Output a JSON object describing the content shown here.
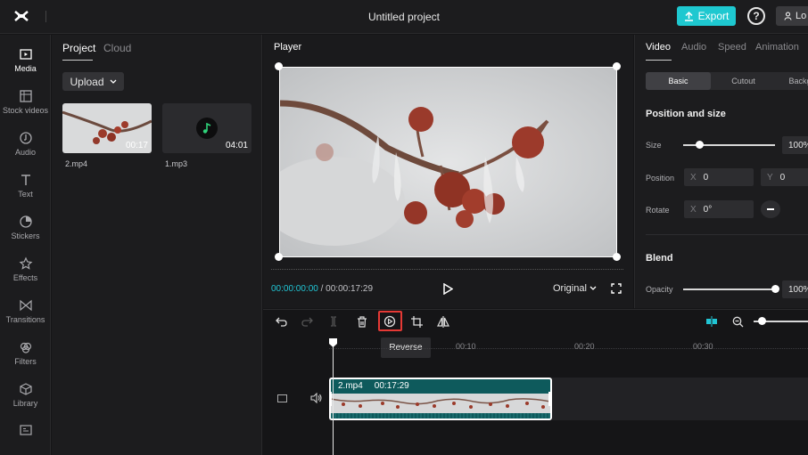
{
  "app": {
    "title": "Untitled project",
    "export_label": "Export",
    "help_label": "?",
    "login_label": "Lo"
  },
  "nav": {
    "items": [
      {
        "label": "Media",
        "icon": "media-icon"
      },
      {
        "label": "Stock videos",
        "icon": "stock-videos-icon"
      },
      {
        "label": "Audio",
        "icon": "audio-icon"
      },
      {
        "label": "Text",
        "icon": "text-icon"
      },
      {
        "label": "Stickers",
        "icon": "stickers-icon"
      },
      {
        "label": "Effects",
        "icon": "effects-icon"
      },
      {
        "label": "Transitions",
        "icon": "transitions-icon"
      },
      {
        "label": "Filters",
        "icon": "filters-icon"
      },
      {
        "label": "Library",
        "icon": "library-icon"
      }
    ]
  },
  "media": {
    "tabs": [
      "Project",
      "Cloud"
    ],
    "upload_label": "Upload",
    "files": [
      {
        "name": "2.mp4",
        "duration": "00:17"
      },
      {
        "name": "1.mp3",
        "duration": "04:01"
      }
    ]
  },
  "player": {
    "title": "Player",
    "current_time": "00:00:00:00",
    "separator": " / ",
    "total_time": "00:00:17:29",
    "ratio_label": "Original"
  },
  "props": {
    "tabs": [
      "Video",
      "Audio",
      "Speed",
      "Animation"
    ],
    "sub_tabs": [
      "Basic",
      "Cutout",
      "Backg"
    ],
    "position_size_title": "Position and size",
    "size_label": "Size",
    "size_value": "100%",
    "size_level": 0.17,
    "position_label": "Position",
    "pos_x_axis": "X",
    "pos_x": "0",
    "pos_y_axis": "Y",
    "pos_y": "0",
    "rotate_label": "Rotate",
    "rotate_axis": "X",
    "rotate_value": "0°",
    "blend_title": "Blend",
    "opacity_label": "Opacity",
    "opacity_value": "100%",
    "opacity_level": 1.0
  },
  "timeline": {
    "tooltip": "Reverse",
    "ticks": [
      "00:10",
      "00:20",
      "00:30"
    ],
    "clip_name": "2.mp4",
    "clip_duration": "00:17:29"
  },
  "colors": {
    "accent": "#1ec8d0",
    "time_current": "#21c5d4",
    "highlight_box": "#e53935"
  }
}
